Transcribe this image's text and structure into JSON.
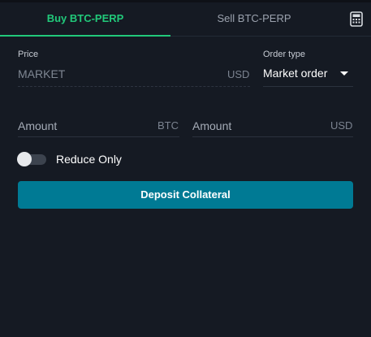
{
  "tabs": {
    "buy_label": "Buy BTC-PERP",
    "sell_label": "Sell BTC-PERP",
    "active": "buy"
  },
  "price": {
    "label": "Price",
    "value": "MARKET",
    "unit": "USD"
  },
  "order_type": {
    "label": "Order type",
    "selected": "Market order"
  },
  "amount_btc": {
    "placeholder": "Amount",
    "unit": "BTC"
  },
  "amount_usd": {
    "placeholder": "Amount",
    "unit": "USD"
  },
  "reduce_only": {
    "label": "Reduce Only",
    "enabled": false
  },
  "deposit_button": {
    "label": "Deposit Collateral"
  },
  "icons": {
    "calculator": "calculator-icon",
    "dropdown": "chevron-down-icon"
  },
  "colors": {
    "background": "#151a23",
    "buy_accent": "#21c97a",
    "button": "#007a94",
    "text_muted": "#7b8390"
  }
}
